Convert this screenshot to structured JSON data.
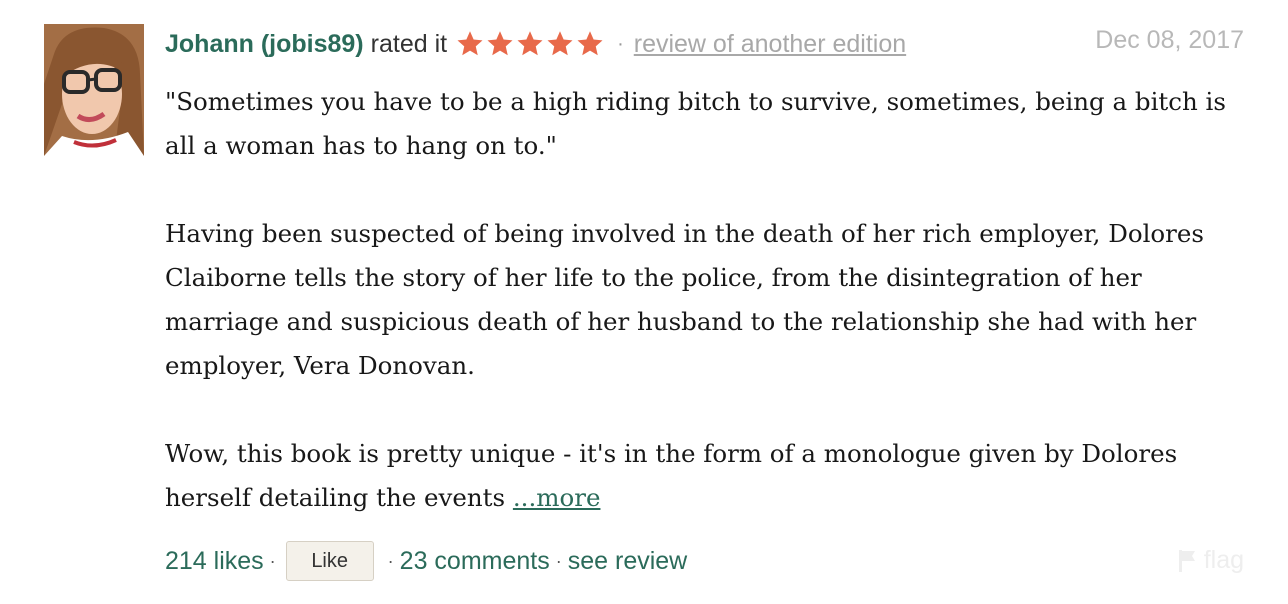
{
  "review": {
    "user_name": "Johann (jobis89)",
    "rated_label": "rated it",
    "rating": 5,
    "rating_max": 5,
    "other_edition": "review of another edition",
    "date": "Dec 08, 2017",
    "paragraphs": [
      "\"Sometimes you have to be a high riding bitch to survive, sometimes, being a bitch is all a woman has to hang on to.\"",
      "Having been suspected of being involved in the death of her rich employer, Dolores Claiborne tells the story of her life to the police, from the disintegration of her marriage and suspicious death of her husband to the relationship she had with her employer, Vera Donovan.",
      "Wow, this book is pretty unique - it's in the form of a monologue given by Dolores herself detailing the events "
    ],
    "more_label": "...more",
    "likes": "214 likes",
    "like_button": "Like",
    "comments": "23 comments",
    "see_review": "see review",
    "flag": "flag"
  },
  "colors": {
    "link": "#2b6b5a",
    "star": "#e8694a",
    "muted": "#a8a8a8"
  },
  "icons": {
    "star": "star-icon",
    "flag": "flag-icon"
  }
}
